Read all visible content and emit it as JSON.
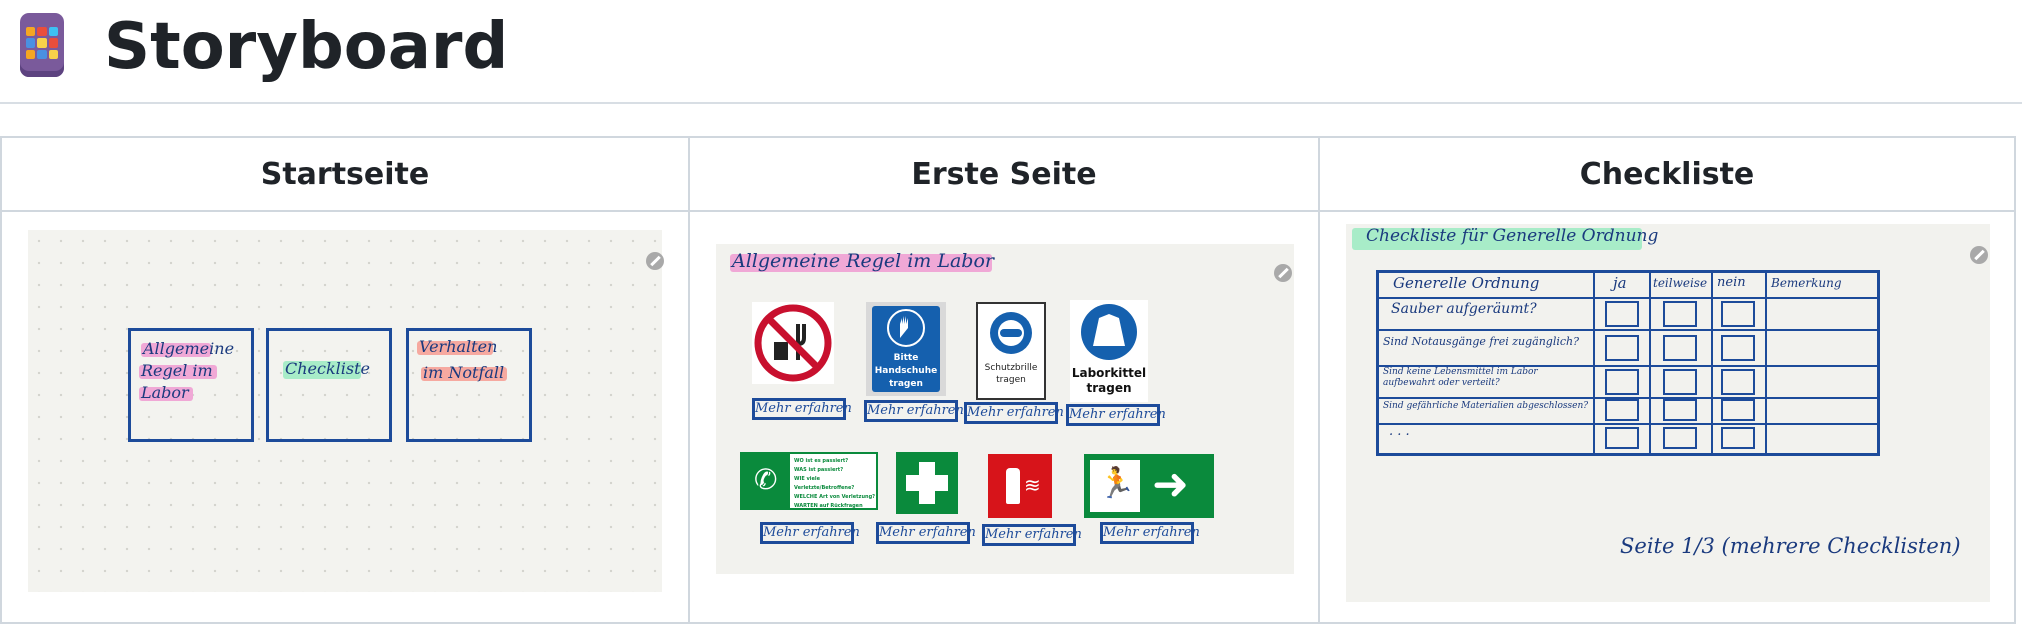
{
  "page": {
    "title": "Storyboard",
    "icon": "storyboard-app-icon"
  },
  "table": {
    "headers": [
      "Startseite",
      "Erste Seite",
      "Checkliste"
    ]
  },
  "startseite": {
    "boxes": [
      "Allgemeine Regel im Labor",
      "Checkliste",
      "Verhalten im Notfall"
    ],
    "box_lines": [
      [
        "Allgemeine",
        "Regel im",
        "Labor"
      ],
      [
        "Checkliste"
      ],
      [
        "Verhalten",
        "im Notfall"
      ]
    ]
  },
  "erste_seite": {
    "heading": "Allgemeine Regel im Labor",
    "signs_row1": [
      {
        "icon": "no-eating-drinking-icon",
        "label": "",
        "link": "Mehr erfahren"
      },
      {
        "icon": "gloves-icon",
        "label": "Bitte Handschuhe tragen",
        "link": "Mehr erfahren"
      },
      {
        "icon": "safety-goggles-icon",
        "label": "Schutzbrille tragen",
        "link": "Mehr erfahren"
      },
      {
        "icon": "lab-coat-icon",
        "label": "Laborkittel tragen",
        "link": "Mehr erfahren"
      }
    ],
    "signs_row2": [
      {
        "icon": "emergency-phone-icon",
        "lines": [
          "WO ist es passiert?",
          "WAS ist passiert?",
          "WIE viele Verletzte/Betroffene?",
          "WELCHE Art von Verletzung?",
          "WARTEN auf Rückfragen"
        ],
        "link": "Mehr erfahren"
      },
      {
        "icon": "first-aid-icon",
        "link": "Mehr erfahren"
      },
      {
        "icon": "fire-extinguisher-icon",
        "link": "Mehr erfahren"
      },
      {
        "icon": "emergency-exit-icon",
        "link": "Mehr erfahren"
      }
    ]
  },
  "checkliste": {
    "heading": "Checkliste für Generelle Ordnung",
    "columns": [
      "Generelle Ordnung",
      "ja",
      "teilweise",
      "nein",
      "Bemerkung"
    ],
    "rows": [
      "Sauber aufgeräumt?",
      "Sind Notausgänge frei zugänglich?",
      "Sind keine Lebensmittel im Labor aufbewahrt oder verteilt?",
      "Sind gefährliche Materialien abgeschlossen?",
      ". . ."
    ],
    "footer": "Seite 1/3 (mehrere Checklisten)"
  },
  "colors": {
    "ink": "#1d4b9a",
    "pink": "#f0a8d6",
    "green": "#a8ecc8",
    "salmon": "#f6a9a0"
  }
}
